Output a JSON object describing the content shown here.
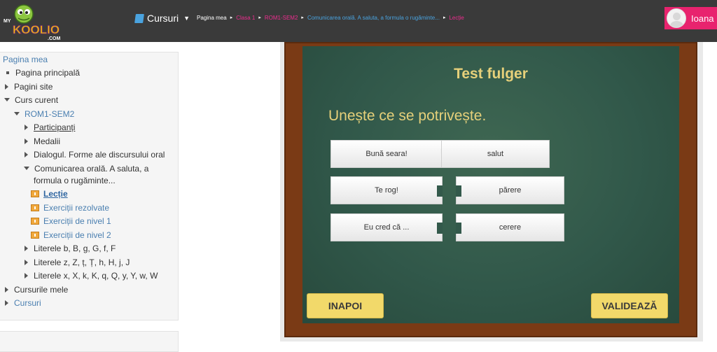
{
  "header": {
    "logo_text": "MY KOOLIO.COM",
    "courses_label": "Cursuri",
    "breadcrumb": [
      "Pagina mea",
      "Clasa 1",
      "ROM1-SEM2",
      "Comunicarea orală. A saluta, a formula o rugăminte...",
      "Lecție"
    ],
    "user_name": "Ioana"
  },
  "sidebar": {
    "items": [
      {
        "label": "Pagina mea"
      },
      {
        "label": "Pagina principală"
      },
      {
        "label": "Pagini site"
      },
      {
        "label": "Curs curent"
      },
      {
        "label": "ROM1-SEM2"
      },
      {
        "label": "Participanți"
      },
      {
        "label": "Medalii"
      },
      {
        "label": "Dialogul. Forme ale discursului oral"
      },
      {
        "label": "Comunicarea orală. A saluta, a"
      },
      {
        "label": "formula o rugăminte..."
      },
      {
        "label": "Lecție"
      },
      {
        "label": "Exerciții rezolvate"
      },
      {
        "label": "Exerciții de nivel 1"
      },
      {
        "label": "Exerciții de nivel 2"
      },
      {
        "label": "Literele b, B, g, G, f, F"
      },
      {
        "label": "Literele z, Z, ț, Ț, h, H, j, J"
      },
      {
        "label": "Literele x, X, k, K, q, Q, y, Y, w, W"
      },
      {
        "label": "Cursurile mele"
      },
      {
        "label": "Cursuri"
      }
    ]
  },
  "board": {
    "title": "Test fulger",
    "instruction": "Unește ce se potrivește.",
    "left_tiles": [
      "Bună seara!",
      "Te rog!",
      "Eu cred că ..."
    ],
    "right_tiles": [
      "salut",
      "părere",
      "cerere"
    ],
    "back_label": "INAPOI",
    "validate_label": "VALIDEAZĂ"
  },
  "colors": {
    "topbar": "#3a3a3a",
    "accent_pink": "#e8236e",
    "chalk_yellow": "#e6d07a",
    "board_green": "#31584a",
    "button_yellow": "#f2d96a"
  }
}
